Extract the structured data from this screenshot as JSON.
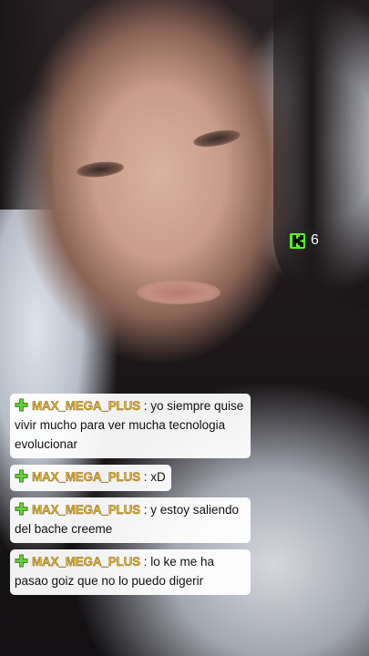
{
  "stream": {
    "viewer_count": "6",
    "platform_icon": "kick-icon",
    "accent_color": "#53fc18"
  },
  "chat": {
    "username_color": "#e1b233",
    "badge_icon": "green-sparkle-badge-icon",
    "separator": ":",
    "messages": [
      {
        "user": "MAX_MEGA_PLUS",
        "text": "yo siempre quise vivir mucho para ver mucha tecnologia evolucionar"
      },
      {
        "user": "MAX_MEGA_PLUS",
        "text": "xD"
      },
      {
        "user": "MAX_MEGA_PLUS",
        "text": "y estoy saliendo del bache creeme"
      },
      {
        "user": "MAX_MEGA_PLUS",
        "text": "lo ke me ha pasao goiz que no lo puedo digerir"
      }
    ]
  }
}
